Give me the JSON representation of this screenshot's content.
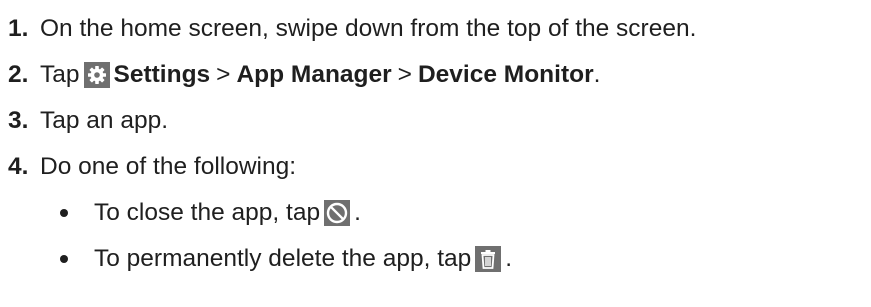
{
  "steps": [
    {
      "num": "1.",
      "text": "On the home screen, swipe down from the top of the screen."
    },
    {
      "num": "2.",
      "tap": "Tap",
      "settings": "Settings",
      "sep1": ">",
      "app_manager": "App Manager",
      "sep2": ">",
      "device_monitor": "Device Monitor",
      "end": "."
    },
    {
      "num": "3.",
      "text": "Tap an app."
    },
    {
      "num": "4.",
      "text": "Do one of the following:"
    }
  ],
  "bullets": [
    {
      "text": "To close the app, tap",
      "icon": "block-icon",
      "end": "."
    },
    {
      "text": "To permanently delete the app, tap",
      "icon": "trash-icon",
      "end": "."
    }
  ],
  "icons": {
    "settings": "gear-icon",
    "close": "block-icon",
    "delete": "trash-icon"
  },
  "colors": {
    "text": "#1f1f1f",
    "icon_bg": "#6f6f6f",
    "icon_fg": "#ffffff"
  }
}
